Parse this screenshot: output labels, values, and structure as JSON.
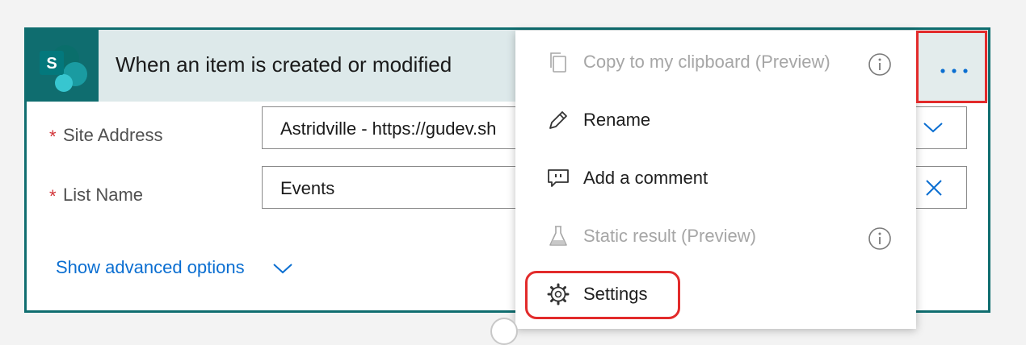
{
  "trigger": {
    "title": "When an item is created or modified",
    "icon": "sharepoint-icon",
    "accent_color": "#0f6d6f",
    "header_color": "#dde9ea"
  },
  "fields": {
    "site_address": {
      "required_mark": "*",
      "label": "Site Address",
      "value": "Astridville - https://gudev.sh"
    },
    "list_name": {
      "required_mark": "*",
      "label": "List Name",
      "value": "Events"
    }
  },
  "advanced": {
    "label": "Show advanced options"
  },
  "menu": {
    "items": [
      {
        "label": "Copy to my clipboard (Preview)",
        "icon": "copy-icon",
        "disabled": true,
        "info": true
      },
      {
        "label": "Rename",
        "icon": "pencil-icon",
        "disabled": false,
        "info": false
      },
      {
        "label": "Add a comment",
        "icon": "comment-icon",
        "disabled": false,
        "info": false
      },
      {
        "label": "Static result (Preview)",
        "icon": "flask-icon",
        "disabled": true,
        "info": true
      },
      {
        "label": "Settings",
        "icon": "gear-icon",
        "disabled": false,
        "info": false
      }
    ]
  },
  "more_button": {
    "icon": "ellipsis-icon",
    "highlight_color": "#e22b2b"
  }
}
